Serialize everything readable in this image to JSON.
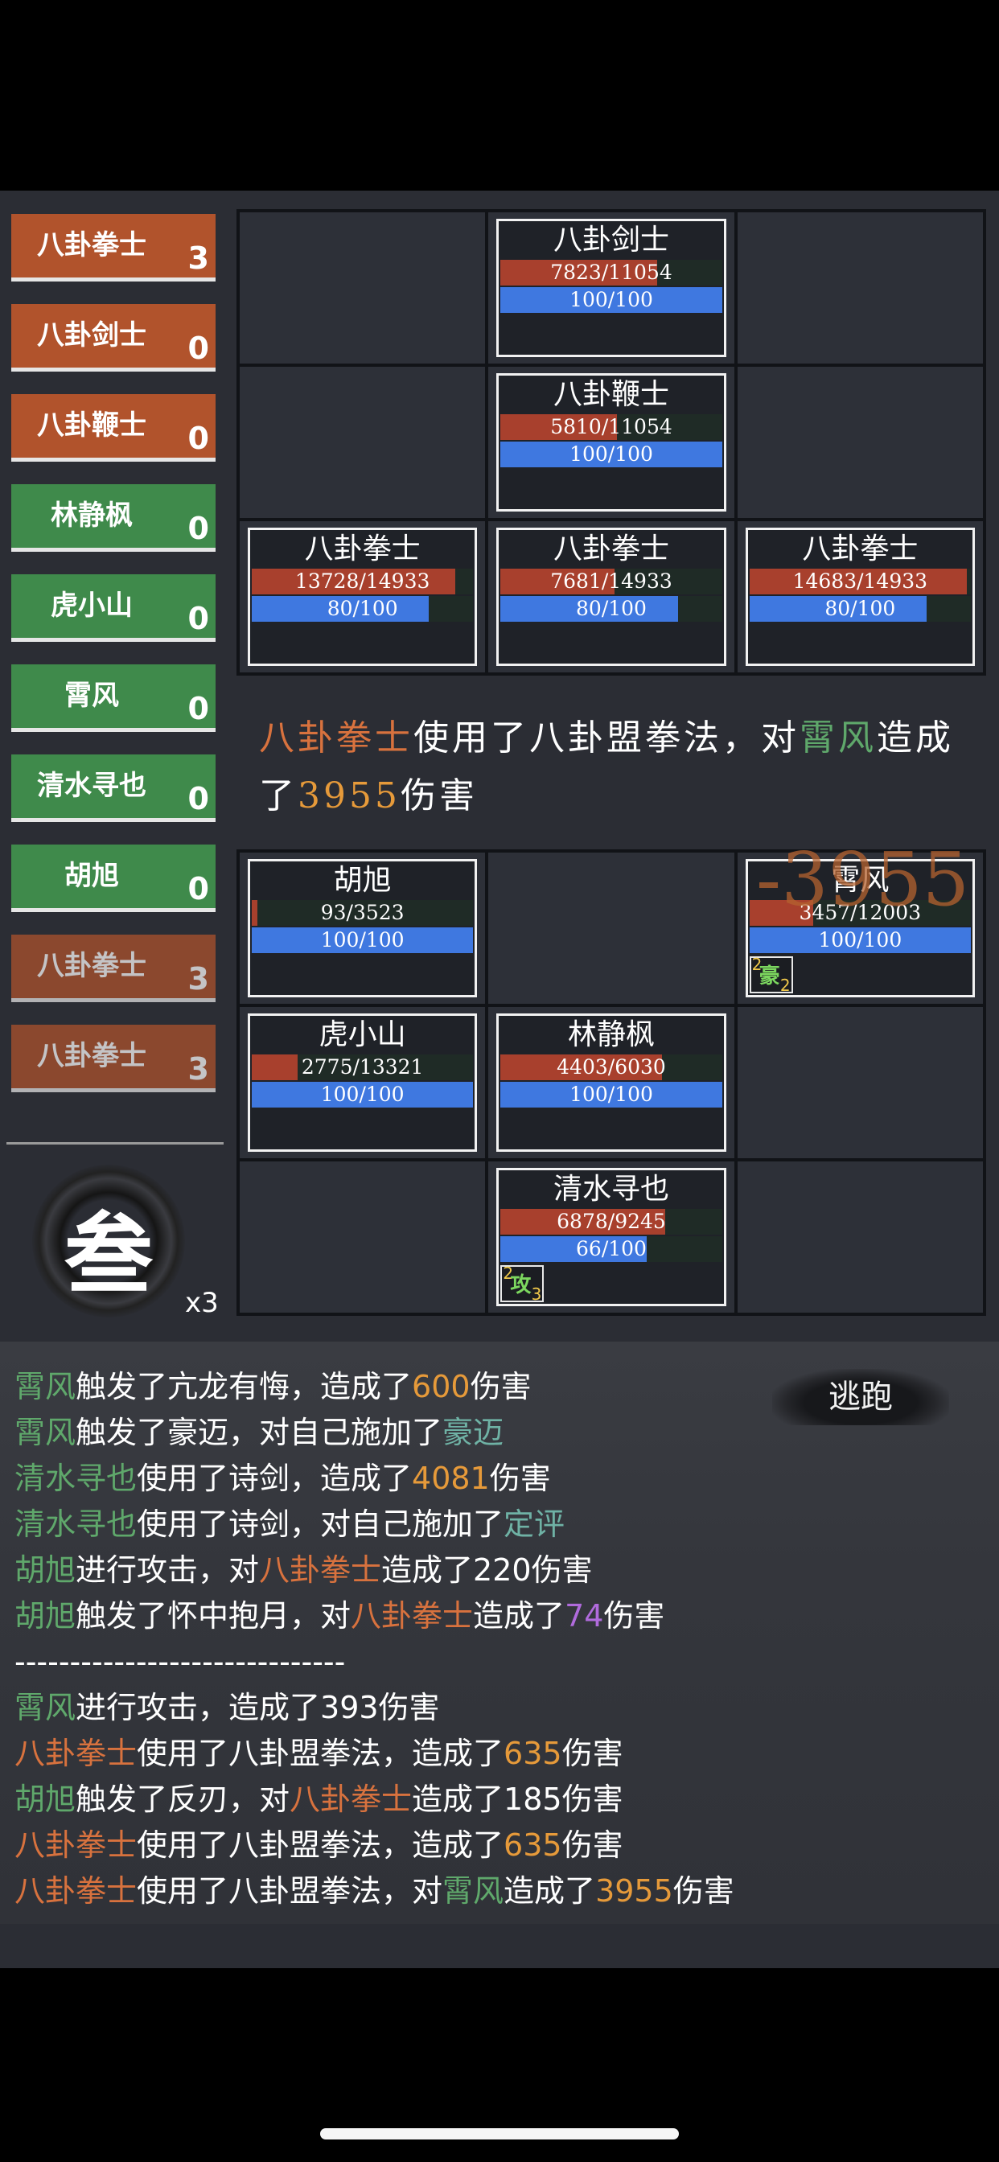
{
  "turn_order": [
    {
      "name": "八卦拳士",
      "count": "3",
      "side": "enemy",
      "dim": false
    },
    {
      "name": "八卦剑士",
      "count": "0",
      "side": "enemy",
      "dim": false
    },
    {
      "name": "八卦鞭士",
      "count": "0",
      "side": "enemy",
      "dim": false
    },
    {
      "name": "林静枫",
      "count": "0",
      "side": "ally",
      "dim": false
    },
    {
      "name": "虎小山",
      "count": "0",
      "side": "ally",
      "dim": false
    },
    {
      "name": "霄风",
      "count": "0",
      "side": "ally",
      "dim": false
    },
    {
      "name": "清水寻也",
      "count": "0",
      "side": "ally",
      "dim": false
    },
    {
      "name": "胡旭",
      "count": "0",
      "side": "ally",
      "dim": false
    },
    {
      "name": "八卦拳士",
      "count": "3",
      "side": "enemy",
      "dim": true
    },
    {
      "name": "八卦拳士",
      "count": "3",
      "side": "enemy",
      "dim": true
    }
  ],
  "speed": {
    "glyph": "叁",
    "multiplier": "x3"
  },
  "enemy_grid": [
    null,
    {
      "name": "八卦剑士",
      "hp": "7823/11054",
      "hp_ratio": 0.708,
      "mp": "100/100",
      "mp_ratio": 1.0
    },
    null,
    null,
    {
      "name": "八卦鞭士",
      "hp": "5810/11054",
      "hp_ratio": 0.526,
      "mp": "100/100",
      "mp_ratio": 1.0
    },
    null,
    {
      "name": "八卦拳士",
      "hp": "13728/14933",
      "hp_ratio": 0.919,
      "mp": "80/100",
      "mp_ratio": 0.8
    },
    {
      "name": "八卦拳士",
      "hp": "7681/14933",
      "hp_ratio": 0.514,
      "mp": "80/100",
      "mp_ratio": 0.8
    },
    {
      "name": "八卦拳士",
      "hp": "14683/14933",
      "hp_ratio": 0.983,
      "mp": "80/100",
      "mp_ratio": 0.8
    }
  ],
  "ally_grid": [
    {
      "name": "胡旭",
      "hp": "93/3523",
      "hp_ratio": 0.026,
      "mp": "100/100",
      "mp_ratio": 1.0
    },
    null,
    {
      "name": "霄风",
      "hp": "3457/12003",
      "hp_ratio": 0.288,
      "mp": "100/100",
      "mp_ratio": 1.0,
      "status": {
        "char": "豪",
        "left": "2",
        "right": "2"
      }
    },
    {
      "name": "虎小山",
      "hp": "2775/13321",
      "hp_ratio": 0.208,
      "mp": "100/100",
      "mp_ratio": 1.0
    },
    {
      "name": "林静枫",
      "hp": "4403/6030",
      "hp_ratio": 0.73,
      "mp": "100/100",
      "mp_ratio": 1.0
    },
    null,
    null,
    {
      "name": "清水寻也",
      "hp": "6878/9245",
      "hp_ratio": 0.744,
      "mp": "66/100",
      "mp_ratio": 0.66,
      "status": {
        "char": "攻",
        "left": "2",
        "right": "3"
      }
    },
    null
  ],
  "damage_float": "-3955",
  "announcement": [
    {
      "t": "八卦拳士",
      "c": "enemy"
    },
    {
      "t": "使用了八卦盟拳法，对",
      "c": ""
    },
    {
      "t": "霄风",
      "c": "ally"
    },
    {
      "t": "造成了",
      "c": ""
    },
    {
      "t": "3955",
      "c": "num"
    },
    {
      "t": "伤害",
      "c": ""
    }
  ],
  "battle_log": [
    [
      {
        "t": "霄风",
        "c": "ally"
      },
      {
        "t": "触发了亢龙有悔，造成了",
        "c": ""
      },
      {
        "t": "600",
        "c": "num"
      },
      {
        "t": "伤害",
        "c": ""
      }
    ],
    [
      {
        "t": "霄风",
        "c": "ally"
      },
      {
        "t": "触发了豪迈，对自己施加了",
        "c": ""
      },
      {
        "t": "豪迈",
        "c": "buff"
      }
    ],
    [
      {
        "t": "清水寻也",
        "c": "ally"
      },
      {
        "t": "使用了诗剑，造成了",
        "c": ""
      },
      {
        "t": "4081",
        "c": "num"
      },
      {
        "t": "伤害",
        "c": ""
      }
    ],
    [
      {
        "t": "清水寻也",
        "c": "ally"
      },
      {
        "t": "使用了诗剑，对自己施加了",
        "c": ""
      },
      {
        "t": "定评",
        "c": "buff"
      }
    ],
    [
      {
        "t": "胡旭",
        "c": "ally"
      },
      {
        "t": "进行攻击，对",
        "c": ""
      },
      {
        "t": "八卦拳士",
        "c": "enemy"
      },
      {
        "t": "造成了220伤害",
        "c": ""
      }
    ],
    [
      {
        "t": "胡旭",
        "c": "ally"
      },
      {
        "t": "触发了怀中抱月，对",
        "c": ""
      },
      {
        "t": "八卦拳士",
        "c": "enemy"
      },
      {
        "t": "造成了",
        "c": ""
      },
      {
        "t": "74",
        "c": "purple"
      },
      {
        "t": "伤害",
        "c": ""
      }
    ],
    [
      {
        "t": "------------------------------",
        "c": ""
      }
    ],
    [
      {
        "t": "霄风",
        "c": "ally"
      },
      {
        "t": "进行攻击，造成了393伤害",
        "c": ""
      }
    ],
    [
      {
        "t": "八卦拳士",
        "c": "enemy"
      },
      {
        "t": "使用了八卦盟拳法，造成了",
        "c": ""
      },
      {
        "t": "635",
        "c": "num"
      },
      {
        "t": "伤害",
        "c": ""
      }
    ],
    [
      {
        "t": "胡旭",
        "c": "ally"
      },
      {
        "t": "触发了反刃，对",
        "c": ""
      },
      {
        "t": "八卦拳士",
        "c": "enemy"
      },
      {
        "t": "造成了185伤害",
        "c": ""
      }
    ],
    [
      {
        "t": "八卦拳士",
        "c": "enemy"
      },
      {
        "t": "使用了八卦盟拳法，造成了",
        "c": ""
      },
      {
        "t": "635",
        "c": "num"
      },
      {
        "t": "伤害",
        "c": ""
      }
    ],
    [
      {
        "t": "八卦拳士",
        "c": "enemy"
      },
      {
        "t": "使用了八卦盟拳法，对",
        "c": ""
      },
      {
        "t": "霄风",
        "c": "ally"
      },
      {
        "t": "造成了",
        "c": ""
      },
      {
        "t": "3955",
        "c": "num"
      },
      {
        "t": "伤害",
        "c": ""
      }
    ]
  ],
  "flee_label": "逃跑",
  "colors": {
    "enemy": "#d8723e",
    "ally": "#5fa86b",
    "num": "#e69a3a",
    "buff": "#6fb2a5",
    "purple": "#b06bdc"
  }
}
